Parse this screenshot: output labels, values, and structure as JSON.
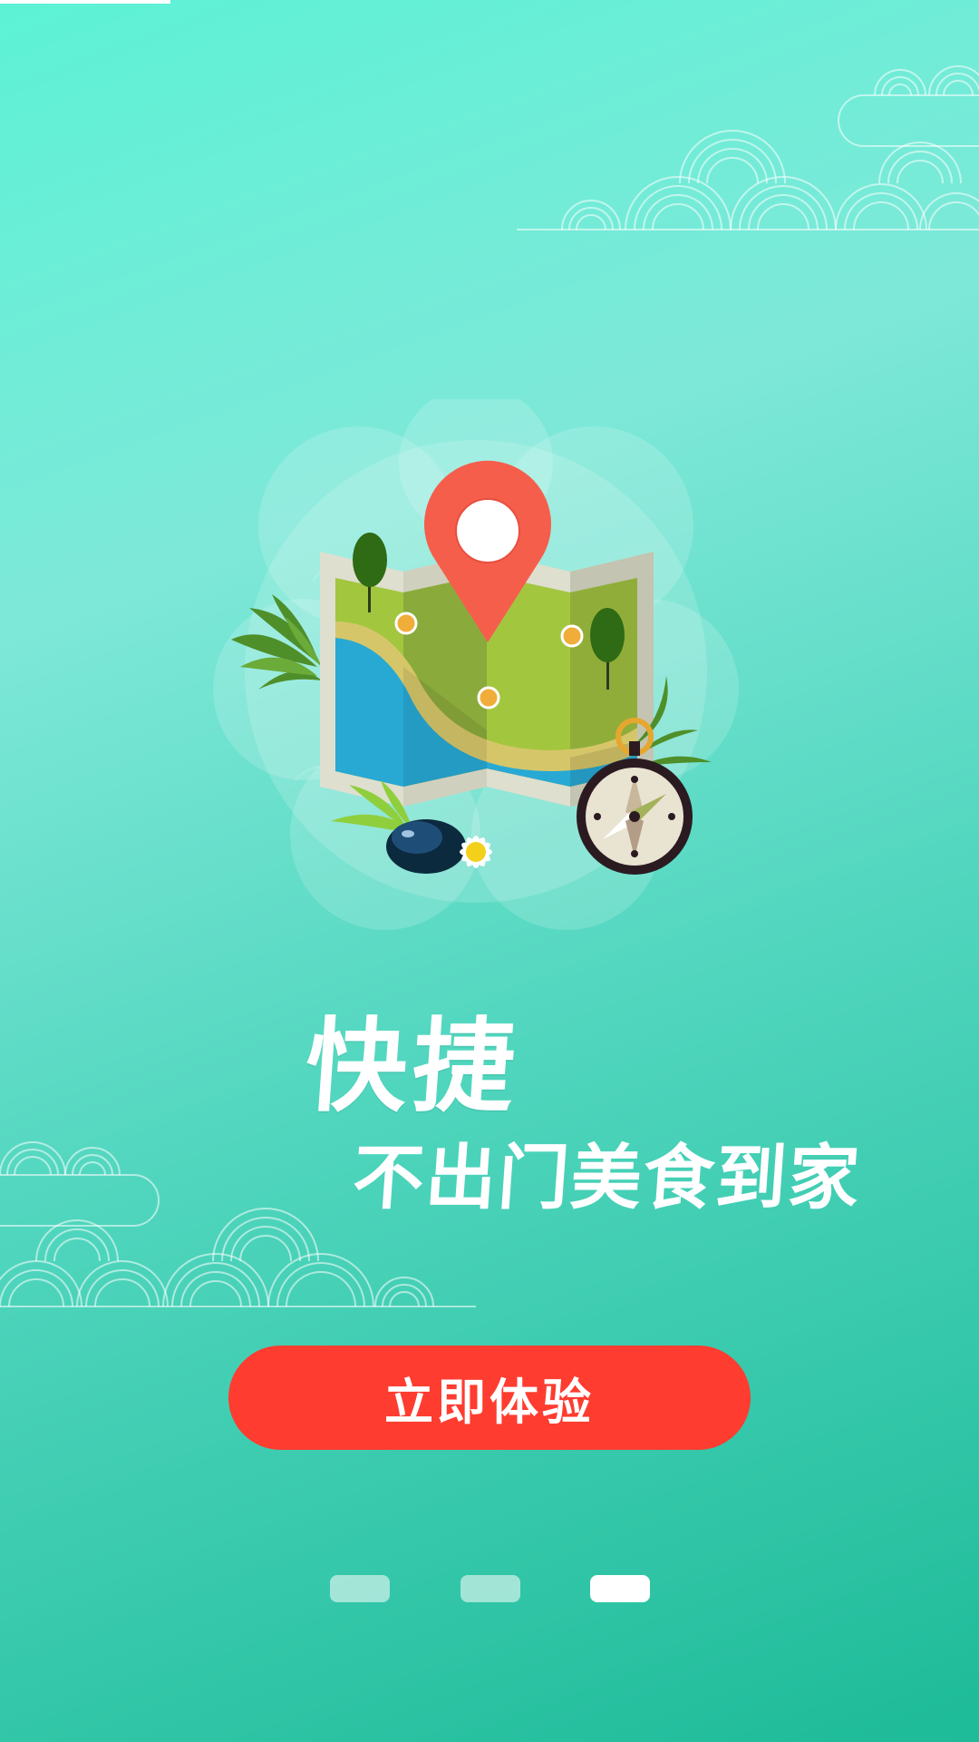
{
  "onboarding": {
    "headline": "快捷",
    "subline": "不出门美食到家",
    "cta_label": "立即体验",
    "current_page": 3,
    "total_pages": 3
  },
  "colors": {
    "background_top": "#5cf2d6",
    "background_bottom": "#1dbb98",
    "cta_background": "#fe3c30",
    "pin": "#f65e4c",
    "water": "#27a9d4",
    "land": "#a3c63f"
  },
  "icons": {
    "hero": "map-with-location-pin-icon",
    "compass": "compass-icon"
  }
}
